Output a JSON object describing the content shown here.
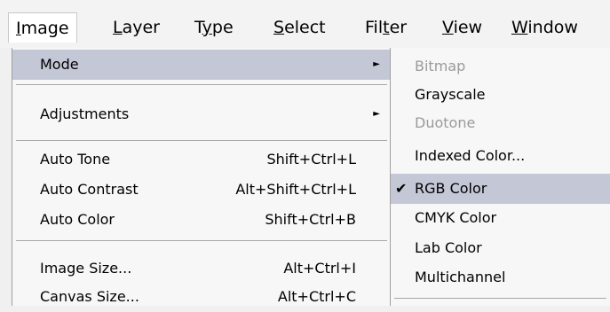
{
  "menubar": {
    "items": [
      {
        "pre": "",
        "ul": "I",
        "post": "mage"
      },
      {
        "pre": "",
        "ul": "L",
        "post": "ayer"
      },
      {
        "pre": "T",
        "ul": "y",
        "post": "pe"
      },
      {
        "pre": "",
        "ul": "S",
        "post": "elect"
      },
      {
        "pre": "Fil",
        "ul": "t",
        "post": "er"
      },
      {
        "pre": "",
        "ul": "V",
        "post": "iew"
      },
      {
        "pre": "",
        "ul": "W",
        "post": "indow"
      }
    ]
  },
  "image_menu": {
    "items": [
      {
        "label": "Mode",
        "shortcut": ""
      },
      {
        "label": "Adjustments",
        "shortcut": ""
      },
      {
        "label": "Auto Tone",
        "shortcut": "Shift+Ctrl+L"
      },
      {
        "label": "Auto Contrast",
        "shortcut": "Alt+Shift+Ctrl+L"
      },
      {
        "label": "Auto Color",
        "shortcut": "Shift+Ctrl+B"
      },
      {
        "label": "Image Size...",
        "shortcut": "Alt+Ctrl+I"
      },
      {
        "label": "Canvas Size...",
        "shortcut": "Alt+Ctrl+C"
      }
    ],
    "submenu_arrow": "►"
  },
  "mode_submenu": {
    "items": [
      {
        "label": "Bitmap",
        "enabled": false,
        "checked": false
      },
      {
        "label": "Grayscale",
        "enabled": true,
        "checked": false
      },
      {
        "label": "Duotone",
        "enabled": false,
        "checked": false
      },
      {
        "label": "Indexed Color...",
        "enabled": true,
        "checked": false
      },
      {
        "label": "RGB Color",
        "enabled": true,
        "checked": true
      },
      {
        "label": "CMYK Color",
        "enabled": true,
        "checked": false
      },
      {
        "label": "Lab Color",
        "enabled": true,
        "checked": false
      },
      {
        "label": "Multichannel",
        "enabled": true,
        "checked": false
      }
    ],
    "check_glyph": "✔"
  },
  "colors": {
    "highlight": "#c4c7d6",
    "disabled_text": "#9a9a9a"
  }
}
